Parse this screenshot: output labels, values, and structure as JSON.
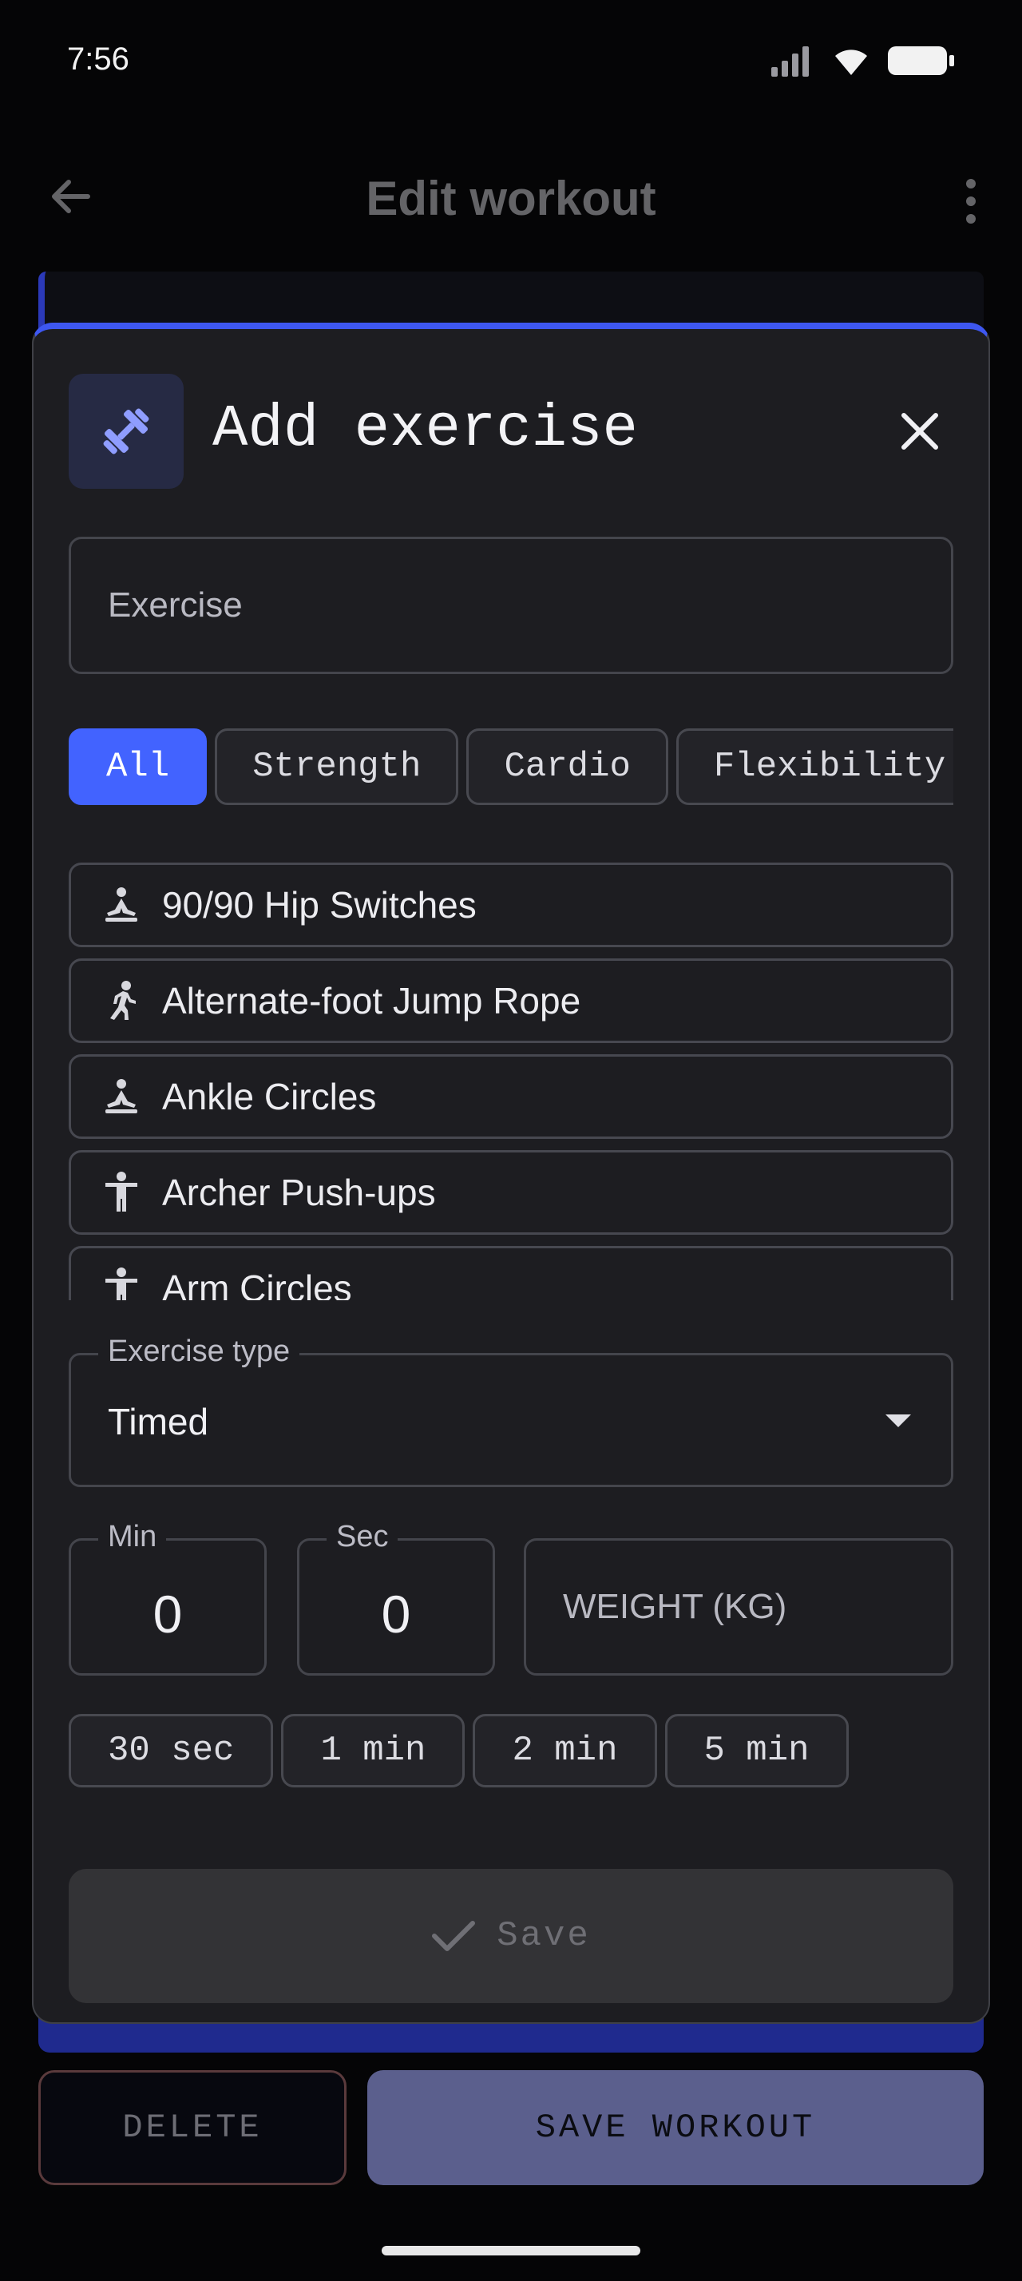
{
  "status_bar": {
    "time": "7:56",
    "icons": [
      "signal-icon",
      "wifi-icon",
      "battery-icon"
    ]
  },
  "app_bar": {
    "title": "Edit workout",
    "back_icon": "arrow-back-icon",
    "menu_icon": "more-vert-icon"
  },
  "dialog": {
    "title": "Add exercise",
    "header_icon": "dumbbell-icon",
    "close_icon": "close-icon",
    "search": {
      "placeholder": "Exercise"
    },
    "filters": [
      {
        "label": "All",
        "active": true
      },
      {
        "label": "Strength",
        "active": false
      },
      {
        "label": "Cardio",
        "active": false
      },
      {
        "label": "Flexibility",
        "active": false
      }
    ],
    "exercises": [
      {
        "label": "90/90 Hip Switches",
        "icon": "meditation-icon"
      },
      {
        "label": "Alternate-foot Jump Rope",
        "icon": "running-icon"
      },
      {
        "label": "Ankle Circles",
        "icon": "meditation-icon"
      },
      {
        "label": "Archer Push-ups",
        "icon": "standing-person-icon"
      },
      {
        "label": "Arm Circles",
        "icon": "standing-person-icon"
      }
    ],
    "exercise_type": {
      "label": "Exercise type",
      "value": "Timed"
    },
    "min": {
      "label": "Min",
      "value": "0"
    },
    "sec": {
      "label": "Sec",
      "value": "0"
    },
    "weight": {
      "placeholder": "WEIGHT (KG)"
    },
    "presets": [
      "30 sec",
      "1 min",
      "2 min",
      "5 min"
    ],
    "save_label": "Save"
  },
  "bottom_actions": {
    "delete_label": "DELETE",
    "save_workout_label": "SAVE WORKOUT"
  },
  "colors": {
    "accent": "#4263ff",
    "dialog_bg": "#1d1d21",
    "page_bg": "#050506"
  }
}
